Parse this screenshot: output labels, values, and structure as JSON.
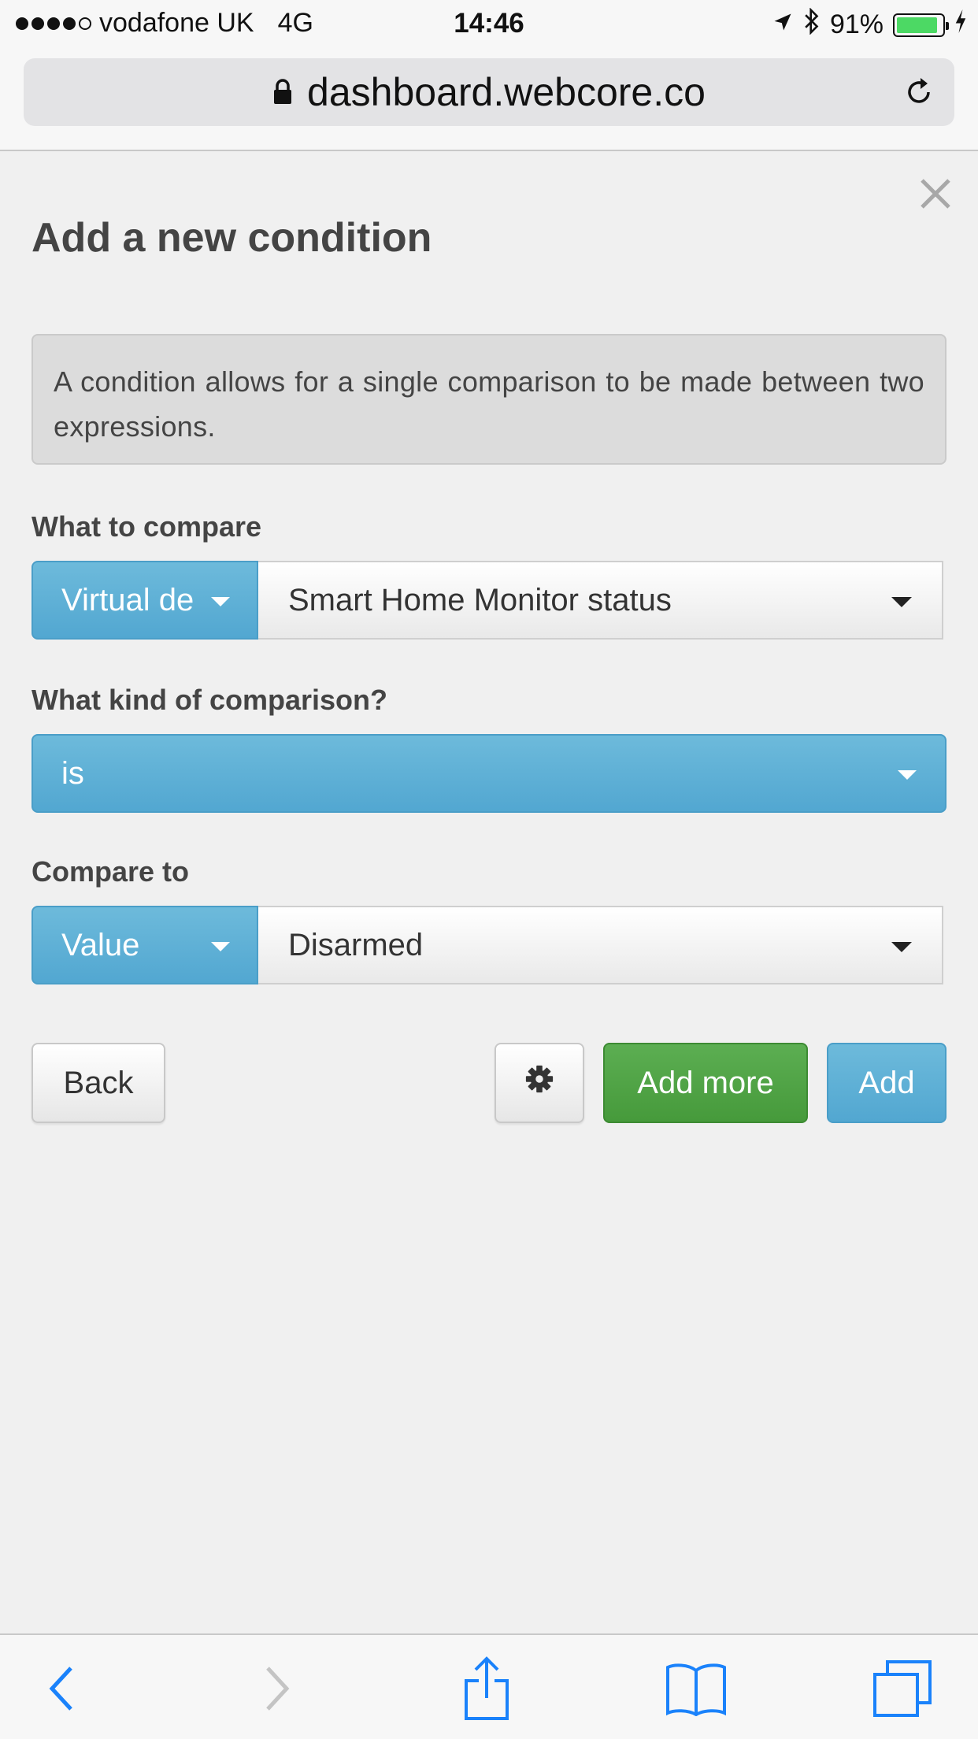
{
  "status_bar": {
    "carrier": "vodafone UK",
    "network": "4G",
    "time": "14:46",
    "battery": "91%",
    "battery_level": 0.91
  },
  "browser": {
    "url": "dashboard.webcore.co"
  },
  "dialog": {
    "title": "Add a new condition",
    "info_text": "A condition allows for a single comparison to be made between two expressions.",
    "what_to_compare": {
      "label": "What to compare",
      "type_value": "Virtual de",
      "attribute_value": "Smart Home Monitor status"
    },
    "comparison": {
      "label": "What kind of comparison?",
      "value": "is"
    },
    "compare_to": {
      "label": "Compare to",
      "type_value": "Value",
      "value": "Disarmed"
    },
    "buttons": {
      "back": "Back",
      "add_more": "Add more",
      "add": "Add"
    }
  },
  "colors": {
    "primary_blue": "#5bb0d8",
    "success_green": "#4fa445",
    "ios_blue": "#1a82fb"
  }
}
